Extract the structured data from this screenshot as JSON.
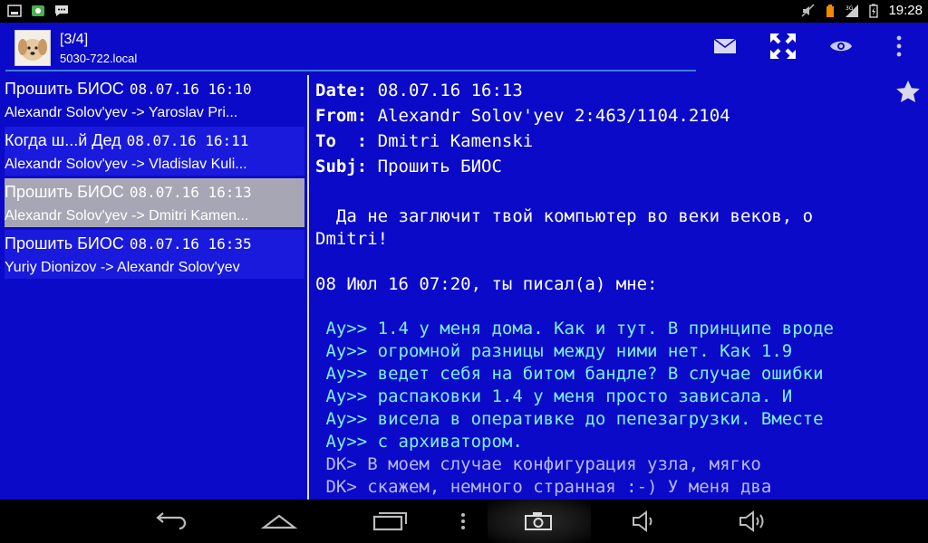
{
  "status": {
    "time": "19:28",
    "network": "3G"
  },
  "header": {
    "title": "[3/4]",
    "subtitle": "5030-722.local"
  },
  "toolbar": {
    "icons": [
      "envelope-icon",
      "fullscreen-icon",
      "eye-icon",
      "overflow-menu-icon"
    ]
  },
  "messages": [
    {
      "subject": "Прошить БИОС",
      "date": "08.07.16  16:10",
      "route": "Alexandr Solov'yev -> Yaroslav Pri..."
    },
    {
      "subject": "Когда ш...й Дед",
      "date": "08.07.16  16:11",
      "route": "Alexandr Solov'yev -> Vladislav Kuli..."
    },
    {
      "subject": "Прошить БИОС",
      "date": "08.07.16  16:13",
      "route": "Alexandr Solov'yev -> Dmitri Kamen..."
    },
    {
      "subject": "Прошить БИОС",
      "date": "08.07.16  16:35",
      "route": "Yuriy Dionizov -> Alexandr Solov'yev"
    }
  ],
  "reader": {
    "date_label": "Date:",
    "date_value": "08.07.16 16:13",
    "from_label": "From:",
    "from_value": "Alexandr Solov'yev 2:463/1104.2104",
    "to_label": "To  :",
    "to_value": "Dmitri Kamenski",
    "subj_label": "Subj:",
    "subj_value": "Прошить БИОС",
    "greeting_1": "  Да не заглючит твой компьютер во веки веков, о",
    "greeting_2": "Dmitri!",
    "wrote": "08 Июл 16 07:20, ты писал(а) мне:",
    "quote_1": [
      " Ay>> 1.4 у меня дома. Как и тут. В принципе вроде",
      " Ay>> огромной разницы между ними нет. Как 1.9",
      " Ay>> ведет себя на битом бандле? В случае ошибки",
      " Ay>> распаковки 1.4 у меня просто зависала. И",
      " Ay>> висела в оперативке до пепезагрузки. Вместе",
      " Ay>> с архиватором."
    ],
    "quote_2": [
      " DK> В моем случае конфигурация узла, мягко",
      " DK> скажем, немного странная :-) У меня два"
    ]
  },
  "colors": {
    "background": "#0a0ac8",
    "selected": "#a6a6b4",
    "quote_level_1": "#7ef0f0",
    "quote_level_2": "#b8b8ee"
  }
}
